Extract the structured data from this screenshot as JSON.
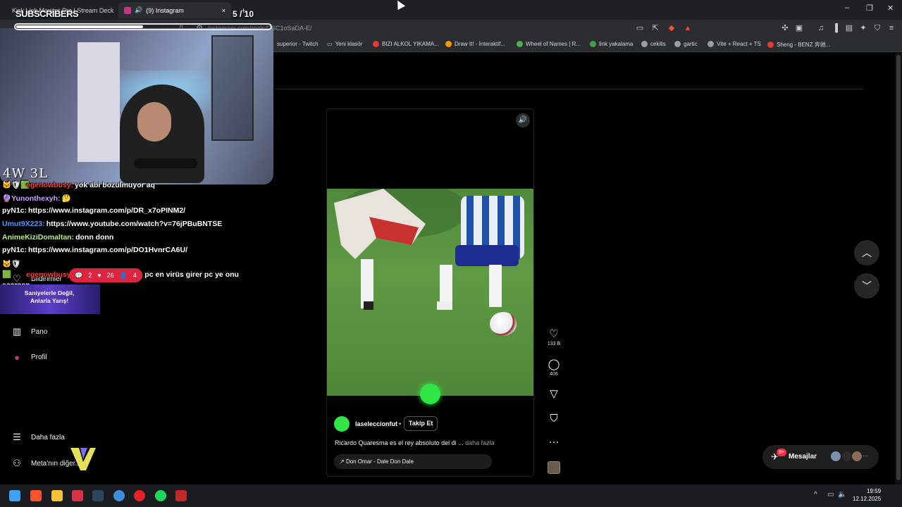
{
  "browser": {
    "tabs": [
      {
        "label": "Kick Link Monitor Pro | Stream Deck"
      },
      {
        "label": "(9) Instagram"
      }
    ],
    "tab_close": "×",
    "new_tab": "+",
    "url": "instagram.com/reels/DSC1oSaDA-E/",
    "window_controls": {
      "minimize": "–",
      "maximize": "❐",
      "close": "✕"
    },
    "bookmarks": [
      {
        "label": "superior - Twitch",
        "color": "#9146ff"
      },
      {
        "label": "Yeni klasör",
        "color": "#888888"
      },
      {
        "label": "BIZI ALKOL YIKAMA...",
        "color": "#e53935"
      },
      {
        "label": "Draw It! - İnteraktif...",
        "color": "#ff9800"
      },
      {
        "label": "Wheel of Names | R...",
        "color": "#4caf50"
      },
      {
        "label": "link yakalama",
        "color": "#43a047"
      },
      {
        "label": "cekilis",
        "color": "#9e9e9e"
      },
      {
        "label": "gartic",
        "color": "#9e9e9e"
      },
      {
        "label": "Vite + React + TS",
        "color": "#9e9e9e"
      },
      {
        "label": "Sheng - BENZ 奔驰...",
        "color": "#e53935"
      }
    ]
  },
  "overlay": {
    "subscribers_label": "SUBSCRIBERS",
    "subscribers_count": "5 / 10",
    "subscribers_progress": 0.5,
    "win_loss": "4W 3L",
    "chat": [
      {
        "user": "egenowbusy:",
        "user_color": "#ff3b3b",
        "text": "yok abi bozulmuyor aq"
      },
      {
        "user": "Yunonthexyh:",
        "user_color": "#c9a0ff",
        "text": ""
      },
      {
        "user": "pyN1c:",
        "user_color": "#ffffff",
        "text": "https://www.instagram.com/p/DR_x7oPINM2/"
      },
      {
        "user": "Umut9X223:",
        "user_color": "#4a9bff",
        "text": "https://www.youtube.com/watch?v=76jPBuBNTSE"
      },
      {
        "user": "AnimeKiziDomaltan:",
        "user_color": "#b7f07a",
        "text": "donn donn"
      },
      {
        "user": "pyN1c:",
        "user_color": "#ffffff",
        "text": "https://www.instagram.com/p/DO1HvnrCA6U/"
      },
      {
        "user": "egenowbusy:",
        "user_color": "#ff3b3b",
        "text": "tm abi hacklenecek pc en virüs girer pc ye onu açarsan"
      }
    ],
    "stats": {
      "comments": "2",
      "likes": "26",
      "viewers": "4"
    },
    "promo": "Saniyelerle Değil, Anlarla Yarış!"
  },
  "sidebar": {
    "items": [
      {
        "label": "Bildirimler",
        "icon": "heart-icon"
      },
      {
        "label": "Pano",
        "icon": "chart-icon"
      },
      {
        "label": "Profil",
        "icon": "profile-icon"
      },
      {
        "label": "Daha fazla",
        "icon": "menu-icon"
      },
      {
        "label": "Meta'nın diğer...",
        "icon": "meta-icon"
      }
    ]
  },
  "reel": {
    "username": "laseleccionfut",
    "follow_label": "Takip Et",
    "caption": "Ricardo Quaresma es el rey absoluto del di ...",
    "more_label": "daha fazla",
    "audio": "Don Omar - Dale Don Dale",
    "likes": "133 B",
    "comments": "406"
  },
  "messages": {
    "label": "Mesajlar",
    "badge": "9+"
  },
  "taskbar": {
    "time": "19:59",
    "date": "12.12.2025"
  }
}
